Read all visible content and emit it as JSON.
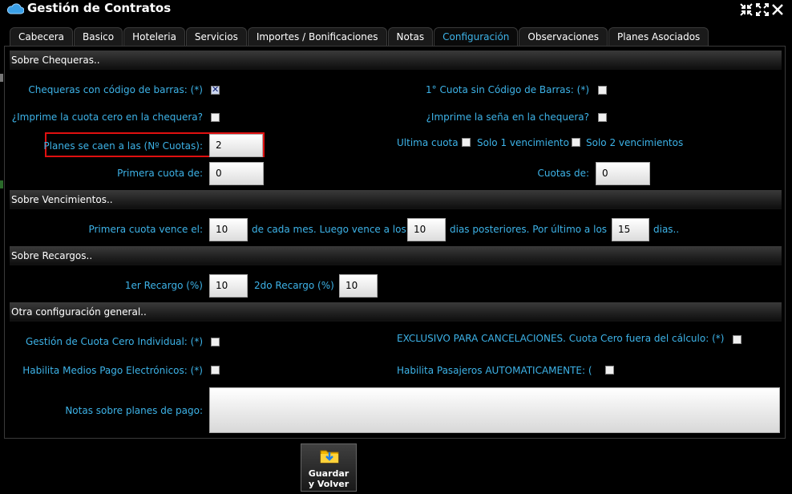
{
  "window": {
    "title": "Gestión de Contratos"
  },
  "tabs": [
    {
      "label": "Cabecera"
    },
    {
      "label": "Basico"
    },
    {
      "label": "Hoteleria"
    },
    {
      "label": "Servicios"
    },
    {
      "label": "Importes / Bonificaciones"
    },
    {
      "label": "Notas"
    },
    {
      "label": "Configuración"
    },
    {
      "label": "Observaciones"
    },
    {
      "label": "Planes Asociados"
    }
  ],
  "active_tab": "Configuración",
  "sections": {
    "chequeras": "Sobre Chequeras..",
    "vencimientos": "Sobre Vencimientos..",
    "recargos": "Sobre Recargos..",
    "general": "Otra configuración general.."
  },
  "chequeras": {
    "codigo_barras_label": "Chequeras con código de barras: (*)",
    "codigo_barras_checked": true,
    "cuota1_sin_codigo_label": "1° Cuota sin Código de Barras: (*)",
    "cuota1_sin_codigo_checked": false,
    "imprime_cuota_cero_label": "¿Imprime la cuota cero en la chequera?",
    "imprime_cuota_cero_checked": false,
    "imprime_sena_label": "¿Imprime la seña en la chequera?",
    "imprime_sena_checked": false,
    "planes_caen_label": "Planes se caen a las (Nº Cuotas):",
    "planes_caen_value": "2",
    "ultima_cuota_label": "Ultima cuota",
    "solo1_label": "Solo 1 vencimiento",
    "solo2_label": "Solo 2 vencimientos",
    "primera_cuota_label": "Primera cuota de:",
    "primera_cuota_value": "0",
    "cuotas_de_label": "Cuotas de:",
    "cuotas_de_value": "0"
  },
  "vencimientos": {
    "primera_vence_label": "Primera cuota vence el:",
    "primera_vence_value": "10",
    "luego_label": "de cada mes. Luego vence a los",
    "luego_value": "10",
    "posteriores_label": "dias posteriores. Por último a los",
    "ultimo_value": "15",
    "dias_label": "dias.."
  },
  "recargos": {
    "recargo1_label": "1er Recargo (%)",
    "recargo1_value": "10",
    "recargo2_label": "2do Recargo (%)",
    "recargo2_value": "10"
  },
  "general": {
    "cuota_cero_individual_label": "Gestión de Cuota Cero Individual: (*)",
    "exclusivo_label": "EXCLUSIVO PARA CANCELACIONES. Cuota Cero fuera del cálculo: (*)",
    "medios_pago_label": "Habilita Medios Pago Electrónicos: (*)",
    "pasajeros_label": "Habilita Pasajeros AUTOMATICAMENTE: (*",
    "notas_label": "Notas sobre planes de pago:",
    "notas_value": ""
  },
  "save_button": {
    "line1": "Guardar",
    "line2": "y Volver",
    "icon": "save-folder-icon"
  },
  "colors": {
    "label_blue": "#3db3e8",
    "background": "#000000",
    "highlight_red": "#e01010"
  }
}
